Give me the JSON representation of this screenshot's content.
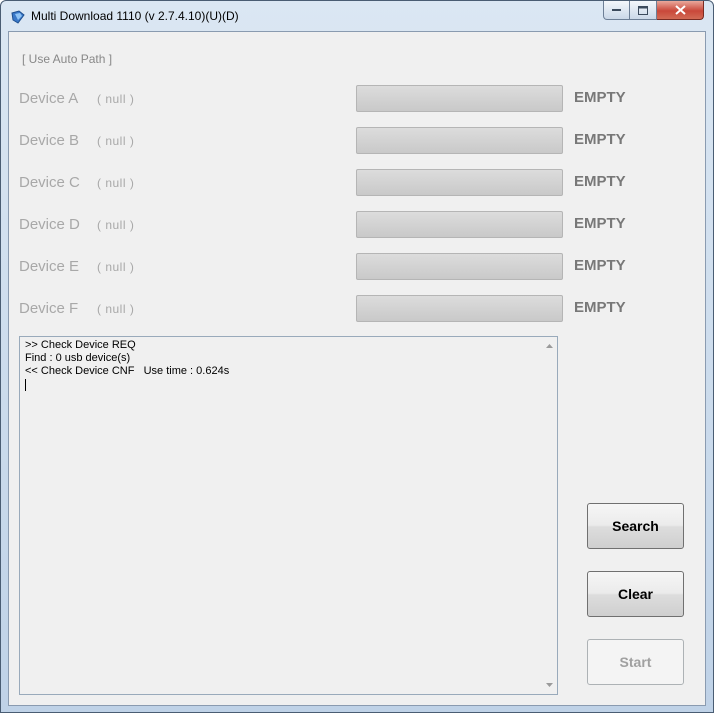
{
  "window": {
    "title": "Multi Download 1110 (v 2.7.4.10)(U)(D)",
    "accent": "#c9483a"
  },
  "path_label": "[ Use Auto Path ]",
  "devices": [
    {
      "name": "Device A",
      "port": "( null )",
      "status": "EMPTY",
      "progress": 0
    },
    {
      "name": "Device B",
      "port": "( null )",
      "status": "EMPTY",
      "progress": 0
    },
    {
      "name": "Device C",
      "port": "( null )",
      "status": "EMPTY",
      "progress": 0
    },
    {
      "name": "Device D",
      "port": "( null )",
      "status": "EMPTY",
      "progress": 0
    },
    {
      "name": "Device E",
      "port": "( null )",
      "status": "EMPTY",
      "progress": 0
    },
    {
      "name": "Device F",
      "port": "( null )",
      "status": "EMPTY",
      "progress": 0
    }
  ],
  "log": {
    "lines": [
      ">> Check Device REQ",
      "Find : 0 usb device(s)",
      "<< Check Device CNF   Use time : 0.624s"
    ]
  },
  "buttons": {
    "search": "Search",
    "clear": "Clear",
    "start": "Start"
  }
}
